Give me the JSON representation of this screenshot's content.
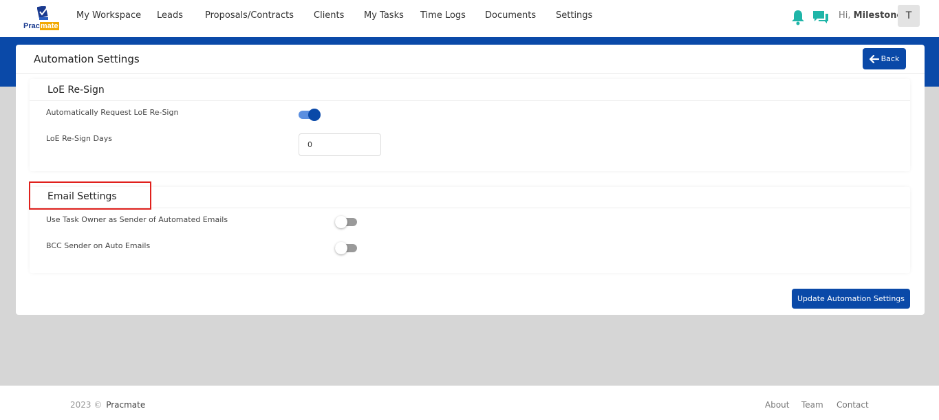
{
  "app": {
    "logo_prefix": "Prac",
    "logo_suffix": "mate"
  },
  "nav": {
    "items": [
      {
        "label": "My Workspace"
      },
      {
        "label": "Leads"
      },
      {
        "label": "Proposals/Contracts"
      },
      {
        "label": "Clients"
      },
      {
        "label": "My Tasks"
      },
      {
        "label": "Time Logs"
      },
      {
        "label": "Documents"
      },
      {
        "label": "Settings"
      }
    ],
    "greeting_prefix": "Hi,",
    "user_name": "Milestone",
    "avatar_initial": "T",
    "icons": [
      "bell-icon",
      "chat-icon"
    ],
    "icon_color": "#1fb5a8"
  },
  "page": {
    "title": "Automation Settings",
    "back_label": "Back"
  },
  "loe_section": {
    "title": "LoE Re-Sign",
    "auto_request_label": "Automatically Request LoE Re-Sign",
    "auto_request_enabled": true,
    "days_label": "LoE Re-Sign Days",
    "days_value": "0"
  },
  "email_section": {
    "title": "Email Settings",
    "task_owner_label": "Use Task Owner as Sender of Automated Emails",
    "task_owner_enabled": false,
    "bcc_label": "BCC Sender on Auto Emails",
    "bcc_enabled": false
  },
  "actions": {
    "update_label": "Update Automation Settings"
  },
  "footer": {
    "year": "2023 ©",
    "brand": "Pracmate",
    "links": [
      "About",
      "Team",
      "Contact"
    ]
  },
  "colors": {
    "primary": "#0a49a8",
    "accent_teal": "#1fb5a8",
    "highlight_red": "#e0201c",
    "background": "#d6d6d6"
  }
}
